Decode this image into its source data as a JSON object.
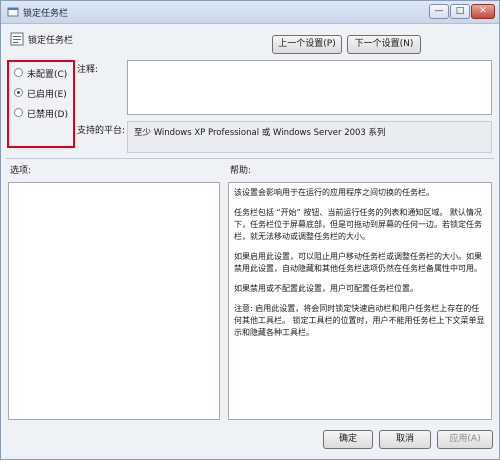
{
  "window": {
    "title": "锁定任务栏"
  },
  "header": {
    "title": "锁定任务栏"
  },
  "nav": {
    "prev_label": "上一个设置(P)",
    "next_label": "下一个设置(N)"
  },
  "options": [
    {
      "label": "未配置(C)",
      "selected": false
    },
    {
      "label": "已启用(E)",
      "selected": true
    },
    {
      "label": "已禁用(D)",
      "selected": false
    }
  ],
  "comment": {
    "label": "注释:",
    "value": ""
  },
  "platform": {
    "label": "支持的平台:",
    "value": "至少 Windows XP Professional 或 Windows Server 2003 系列"
  },
  "options_panel": {
    "label": "选项:"
  },
  "help": {
    "label": "帮助:",
    "paragraphs": [
      "该设置会影响用于在运行的应用程序之间切换的任务栏。",
      "任务栏包括 “开始” 按钮、当前运行任务的列表和通知区域。 默认情况下，任务栏位于屏幕底部，但是可拖动到屏幕的任何一边。若锁定任务栏，就无法移动或调整任务栏的大小。",
      "如果启用此设置，可以阻止用户移动任务栏或调整任务栏的大小。如果禁用此设置，自动隐藏和其他任务栏选项仍然在任务栏备属性中可用。",
      "如果禁用或不配置此设置，用户可配置任务栏位置。",
      "注意: 启用此设置，将会同时锁定快速启动栏和用户任务栏上存在的任何其他工具栏。 锁定工具栏的位置时，用户不能用任务栏上下文菜单显示和隐藏各种工具栏。"
    ]
  },
  "footer": {
    "ok_label": "确定",
    "cancel_label": "取消",
    "apply_label": "应用(A)"
  },
  "colors": {
    "highlight": "#e1001a",
    "accent": "#1c5fb8"
  }
}
